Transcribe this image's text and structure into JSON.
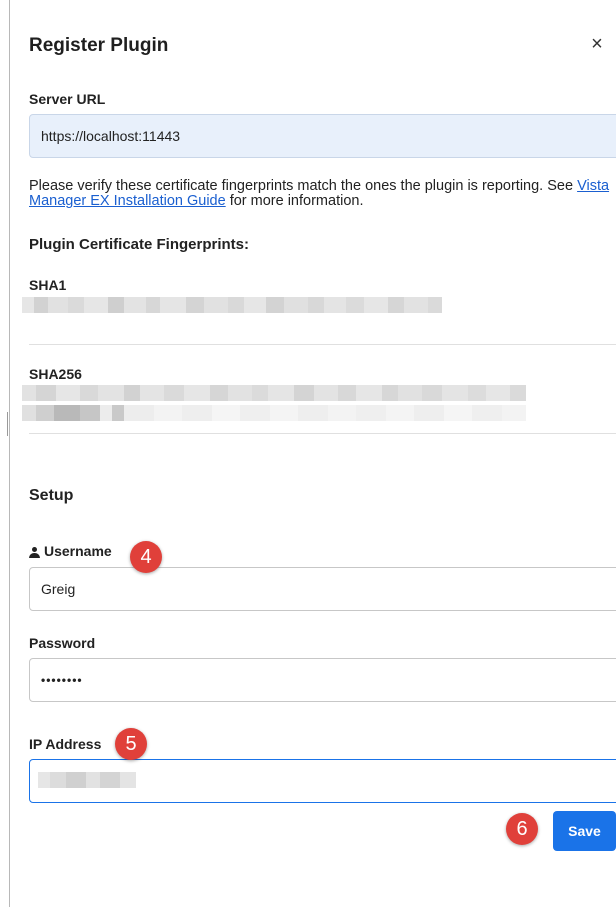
{
  "dialog": {
    "title": "Register Plugin",
    "close_glyph": "×"
  },
  "server": {
    "label": "Server URL",
    "value": "https://localhost:11443"
  },
  "verify": {
    "text_before": "Please verify these certificate fingerprints match the ones the plugin is reporting. See ",
    "link_text": "Vista Manager EX Installation Guide",
    "text_after": " for more information."
  },
  "fingerprints": {
    "heading": "Plugin Certificate Fingerprints:",
    "sha1_label": "SHA1",
    "sha256_label": "SHA256"
  },
  "setup": {
    "heading": "Setup",
    "username_label": "Username",
    "username_value": "Greig",
    "password_label": "Password",
    "password_value": "••••••••",
    "ip_label": "IP Address"
  },
  "actions": {
    "save_label": "Save"
  },
  "annotations": [
    "4",
    "5",
    "6"
  ],
  "colors": {
    "primary": "#1a73e8",
    "badge": "#e0403a",
    "server_input_bg": "#e8f0fb",
    "link": "#1a5fd0"
  }
}
